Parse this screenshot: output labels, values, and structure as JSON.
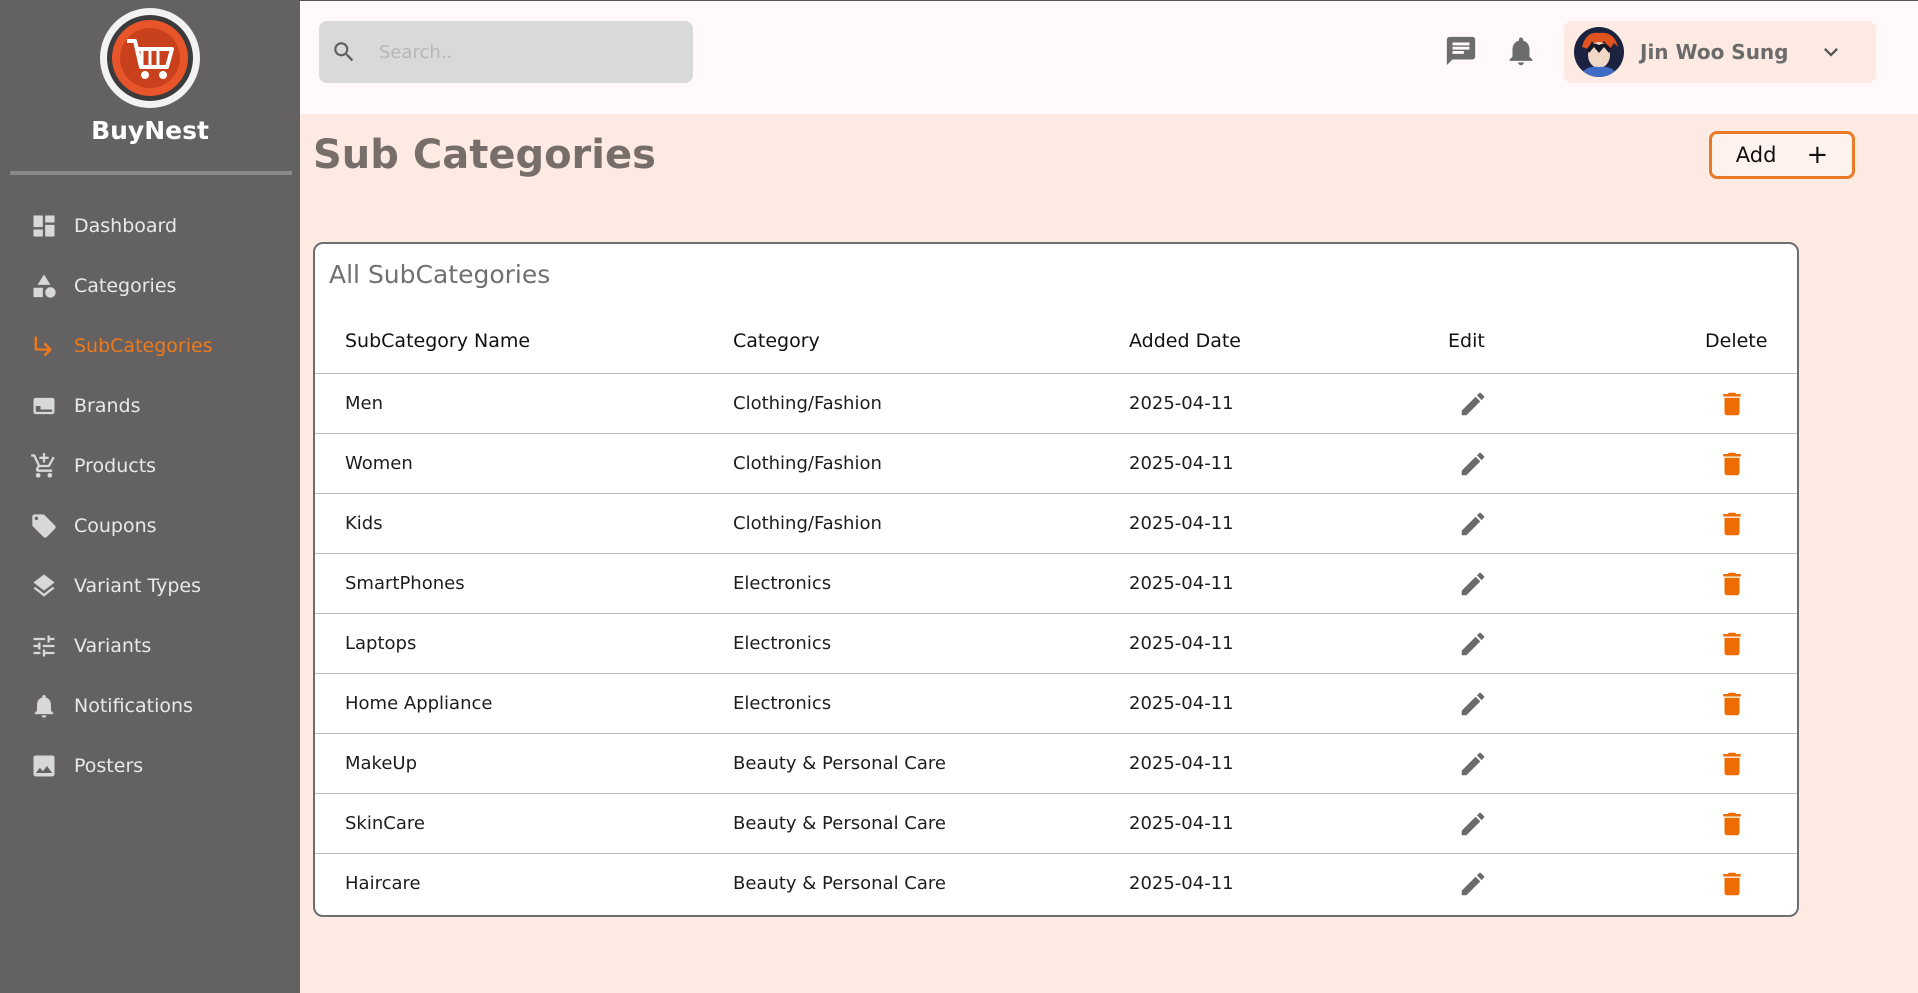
{
  "brand": {
    "name": "BuyNest",
    "logo": "shopping-cart-logo",
    "accent": "#f07a1a"
  },
  "sidebar": {
    "items": [
      {
        "label": "Dashboard",
        "icon": "dashboard-icon",
        "active": false
      },
      {
        "label": "Categories",
        "icon": "category-shapes-icon",
        "active": false
      },
      {
        "label": "SubCategories",
        "icon": "subdirectory-arrow-icon",
        "active": true
      },
      {
        "label": "Brands",
        "icon": "brand-card-icon",
        "active": false
      },
      {
        "label": "Products",
        "icon": "shopping-cart-icon",
        "active": false
      },
      {
        "label": "Coupons",
        "icon": "tag-icon",
        "active": false
      },
      {
        "label": "Variant Types",
        "icon": "layers-icon",
        "active": false
      },
      {
        "label": "Variants",
        "icon": "tune-icon",
        "active": false
      },
      {
        "label": "Notifications",
        "icon": "bell-icon",
        "active": false
      },
      {
        "label": "Posters",
        "icon": "image-icon",
        "active": false
      }
    ]
  },
  "header": {
    "search_placeholder": "Search..",
    "user_name": "Jin Woo Sung"
  },
  "main": {
    "title": "Sub Categories",
    "add_label": "Add",
    "add_symbol": "+"
  },
  "table": {
    "title": "All SubCategories",
    "columns": [
      "SubCategory Name",
      "Category",
      "Added Date",
      "Edit",
      "Delete"
    ],
    "rows": [
      {
        "name": "Men",
        "category": "Clothing/Fashion",
        "date": "2025-04-11"
      },
      {
        "name": "Women",
        "category": "Clothing/Fashion",
        "date": "2025-04-11"
      },
      {
        "name": "Kids",
        "category": "Clothing/Fashion",
        "date": "2025-04-11"
      },
      {
        "name": "SmartPhones",
        "category": "Electronics",
        "date": "2025-04-11"
      },
      {
        "name": "Laptops",
        "category": "Electronics",
        "date": "2025-04-11"
      },
      {
        "name": "Home Appliance",
        "category": "Electronics",
        "date": "2025-04-11"
      },
      {
        "name": "MakeUp",
        "category": "Beauty & Personal Care",
        "date": "2025-04-11"
      },
      {
        "name": "SkinCare",
        "category": "Beauty & Personal Care",
        "date": "2025-04-11"
      },
      {
        "name": "Haircare",
        "category": "Beauty & Personal Care",
        "date": "2025-04-11"
      }
    ]
  }
}
